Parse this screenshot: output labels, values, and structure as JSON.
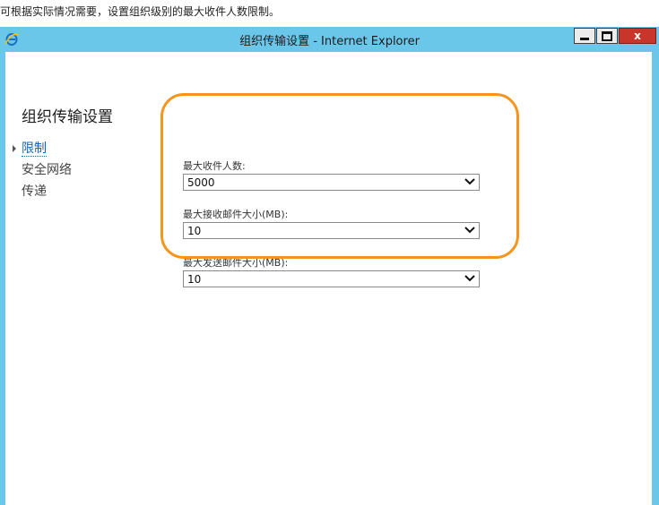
{
  "caption": "可根据实际情况需要，设置组织级别的最大收件人数限制。",
  "window": {
    "title": "组织传输设置 - Internet Explorer",
    "icon": "internet-explorer-icon",
    "controls": {
      "minimize": "minimize-icon",
      "maximize": "maximize-icon",
      "close": "x"
    }
  },
  "page": {
    "title": "组织传输设置"
  },
  "nav": {
    "items": [
      {
        "label": "限制",
        "active": true
      },
      {
        "label": "安全网络",
        "active": false
      },
      {
        "label": "传递",
        "active": false
      }
    ]
  },
  "form": {
    "fields": [
      {
        "label": "最大收件人数:",
        "value": "5000"
      },
      {
        "label": "最大接收邮件大小(MB):",
        "value": "10"
      },
      {
        "label": "最大发送邮件大小(MB):",
        "value": "10"
      }
    ]
  },
  "colors": {
    "titlebar": "#6bc7ea",
    "highlight": "#f5951e",
    "close_button": "#c8352b",
    "active_nav": "#1066b8"
  }
}
